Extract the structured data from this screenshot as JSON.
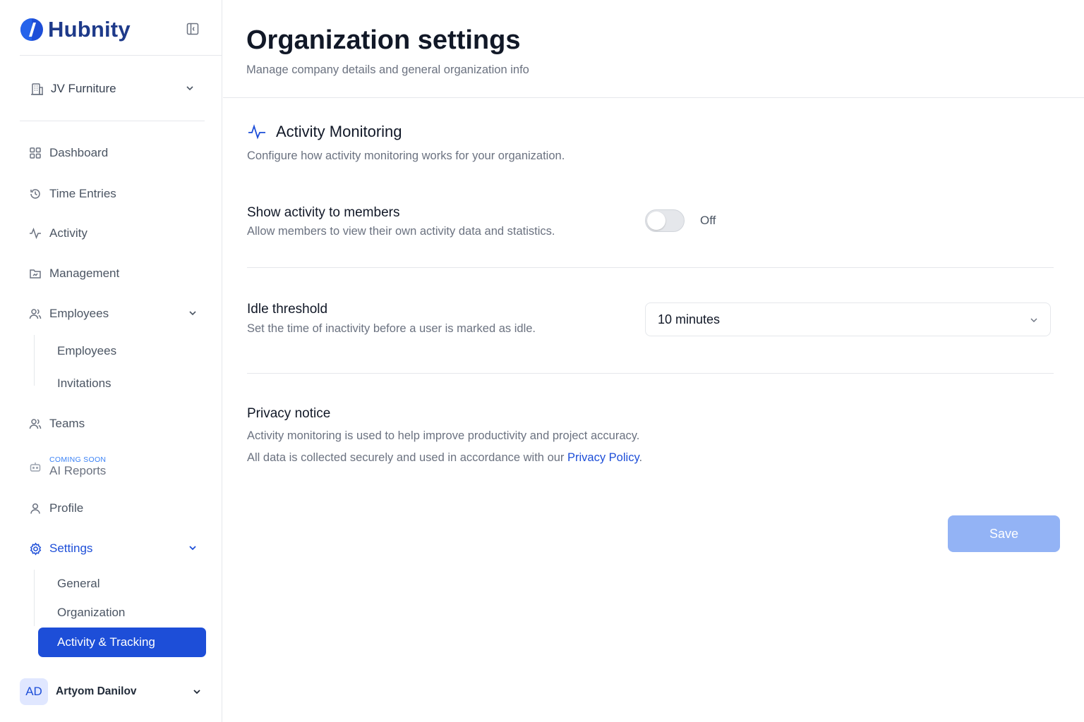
{
  "brand": {
    "name": "Hubnity",
    "color": "#1e3a8a",
    "accent": "#1d4ed8"
  },
  "org_selector": {
    "label": "JV Furniture"
  },
  "sidebar": {
    "items": [
      {
        "label": "Dashboard",
        "icon": "grid-icon"
      },
      {
        "label": "Time Entries",
        "icon": "history-icon"
      },
      {
        "label": "Activity",
        "icon": "pulse-icon"
      },
      {
        "label": "Management",
        "icon": "folder-chart-icon"
      },
      {
        "label": "Employees",
        "icon": "users-icon"
      },
      {
        "label": "Teams",
        "icon": "team-icon"
      },
      {
        "label": "AI Reports",
        "icon": "robot-icon",
        "badge": "COMING SOON"
      },
      {
        "label": "Profile",
        "icon": "user-icon"
      },
      {
        "label": "Settings",
        "icon": "gear-icon"
      }
    ],
    "employees_sub": [
      "Employees",
      "Invitations"
    ],
    "settings_sub": [
      "General",
      "Organization",
      "Activity & Tracking"
    ]
  },
  "user": {
    "initials": "AD",
    "name": "Artyom Danilov"
  },
  "page": {
    "title": "Organization settings",
    "subtitle": "Manage company details and general organization info"
  },
  "section": {
    "title": "Activity Monitoring",
    "subtitle": "Configure how activity monitoring works for your organization."
  },
  "show_activity": {
    "title": "Show activity to members",
    "desc": "Allow members to view their own activity data and statistics.",
    "state_label": "Off",
    "enabled": false
  },
  "idle": {
    "title": "Idle threshold",
    "desc": "Set the time of inactivity before a user is marked as idle.",
    "value": "10 minutes"
  },
  "privacy": {
    "title": "Privacy notice",
    "line1": "Activity monitoring is used to help improve productivity and project accuracy.",
    "line2_prefix": "All data is collected securely and used in accordance with our ",
    "link": "Privacy Policy",
    "line2_suffix": "."
  },
  "save_label": "Save"
}
